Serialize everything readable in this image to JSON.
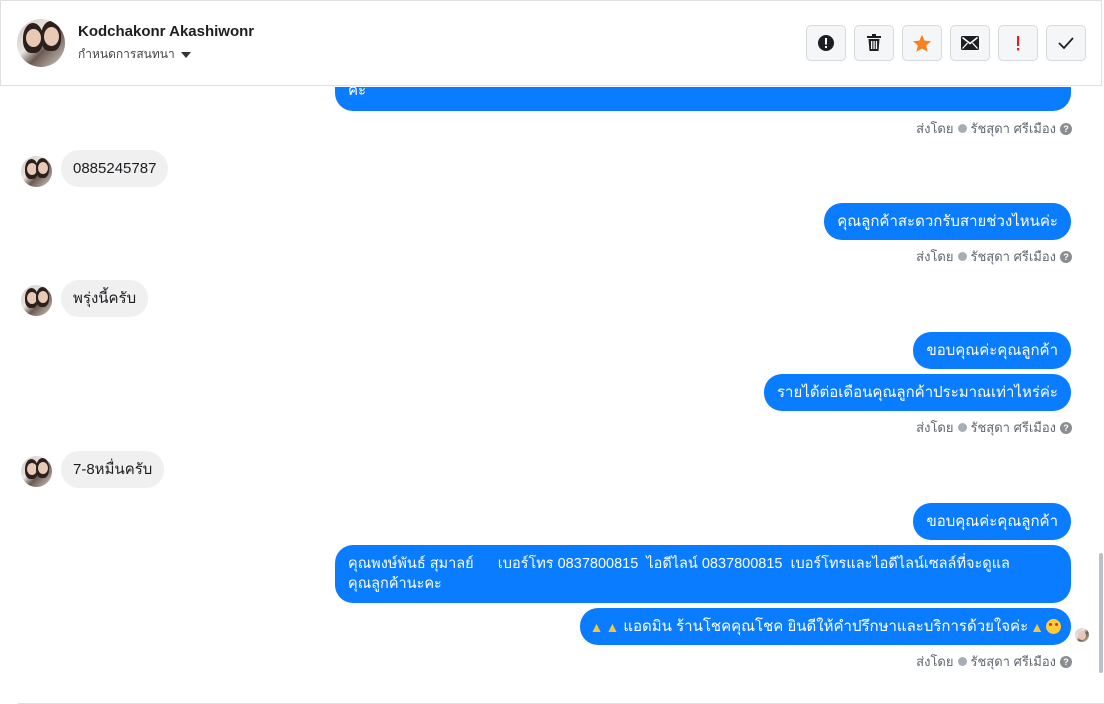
{
  "header": {
    "contact_name": "Kodchakonr Akashiwonr",
    "subtitle": "กำหนดการสนทนา",
    "buttons": [
      {
        "name": "spam-button",
        "icon": "alert-circle-icon"
      },
      {
        "name": "delete-button",
        "icon": "trash-icon"
      },
      {
        "name": "star-button",
        "icon": "star-icon"
      },
      {
        "name": "mark-unread-button",
        "icon": "envelope-icon"
      },
      {
        "name": "important-button",
        "icon": "exclamation-icon"
      },
      {
        "name": "done-button",
        "icon": "checkmark-icon"
      }
    ]
  },
  "messages": {
    "out_partial": "คะ",
    "in_1": "0885245787",
    "out_1": "คุณลูกค้าสะดวกรับสายช่วงไหนค่ะ",
    "in_2": "พรุ่งนี้ครับ",
    "out_2a": "ขอบคุณค่ะคุณลูกค้า",
    "out_2b": "รายได้ต่อเดือนคุณลูกค้าประมาณเท่าไหร่ค่ะ",
    "in_3": "7-8หมื่นครับ",
    "out_3a": "ขอบคุณค่ะคุณลูกค้า",
    "out_3b_line1": "คุณพงษ์พันธ์ สุมาลย์      เบอร์โทร 0837800815  ไอดีไลน์ 0837800815  เบอร์โทรและไอดีไลน์เซลล์ที่จะดูแล",
    "out_3b_line2": "คุณลูกค้านะคะ",
    "out_3c": "แอดมิน ร้านโชคคุณโชค ยินดีให้คำปรึกษาและบริการด้วยใจค่ะ"
  },
  "sent_by": {
    "prefix": "ส่งโดย",
    "agent": "รัชสุดา ศรีเมือง"
  },
  "colors": {
    "outgoing_bubble": "#0a7cff",
    "incoming_bubble": "#f0f0f0",
    "star_accent": "#f5821f",
    "important_accent": "#e02020"
  }
}
